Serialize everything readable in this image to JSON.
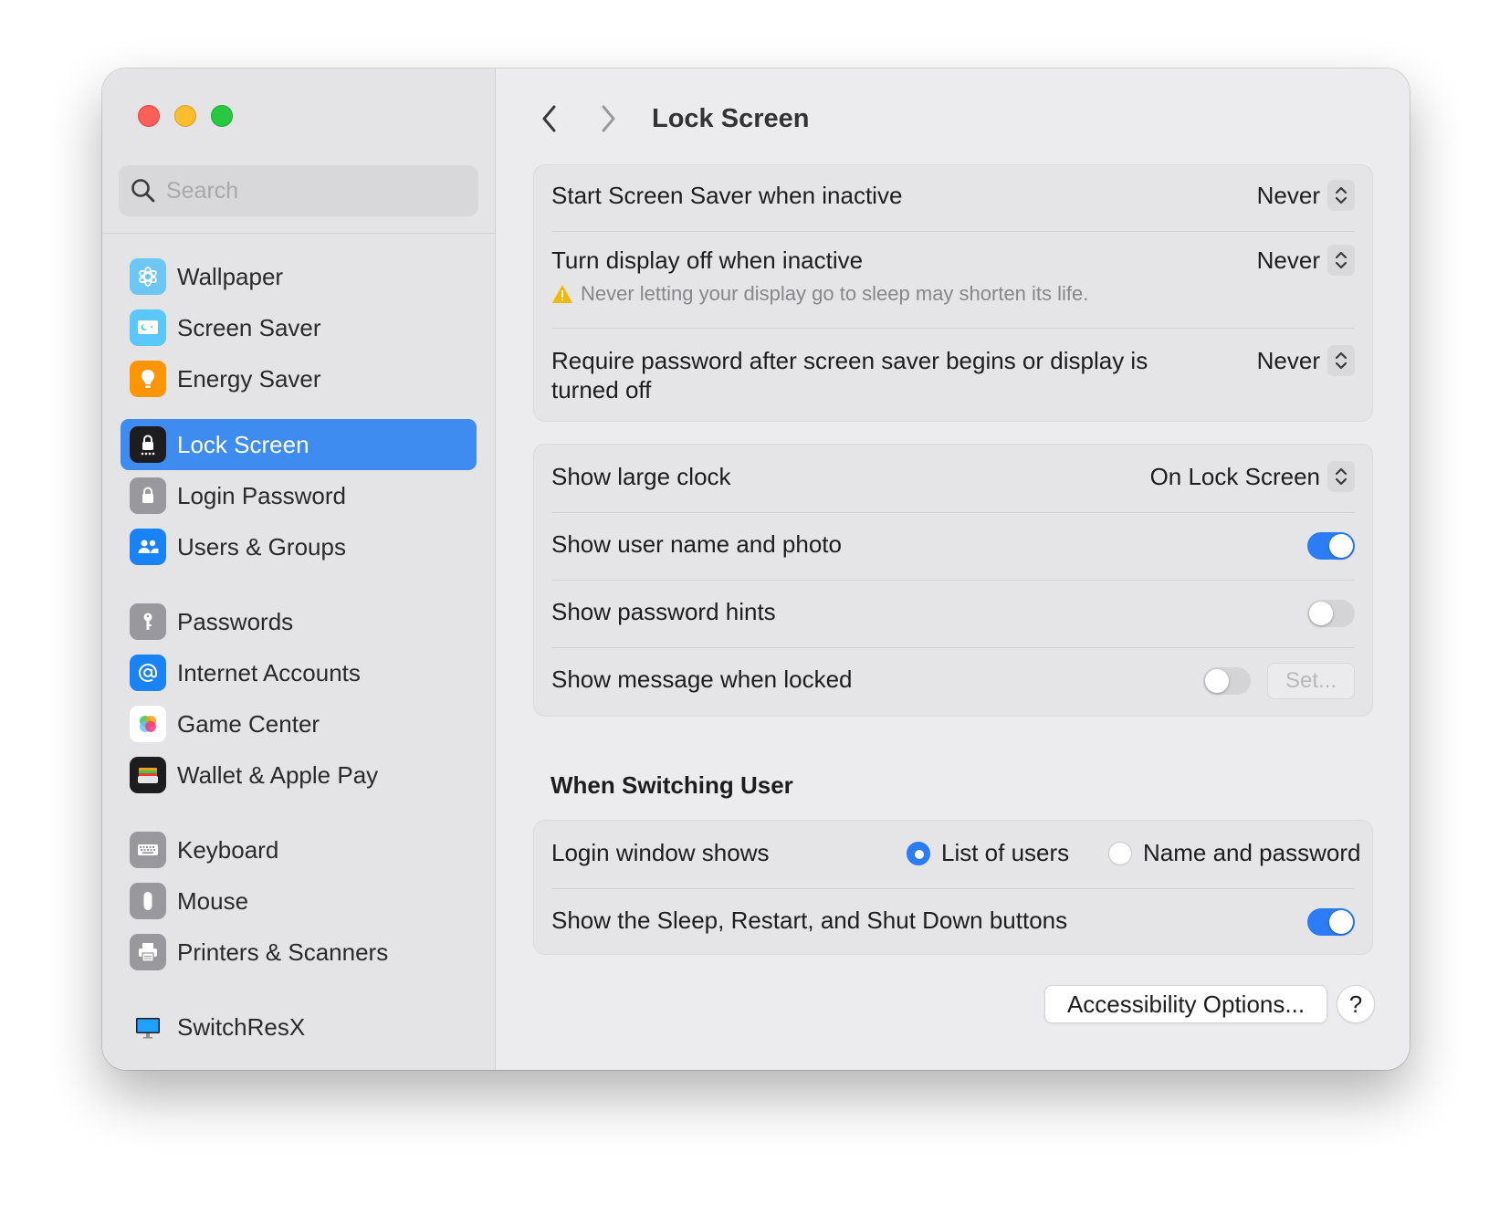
{
  "sidebar": {
    "search_placeholder": "Search",
    "items": [
      {
        "label": "Wallpaper",
        "icon": "wallpaper-icon",
        "color": "#5ac8fa"
      },
      {
        "label": "Screen Saver",
        "icon": "screen-saver-icon",
        "color": "#5ac8fa"
      },
      {
        "label": "Energy Saver",
        "icon": "energy-saver-icon",
        "color": "#ff9500"
      },
      {
        "label": "Lock Screen",
        "icon": "lock-screen-icon",
        "color": "#1d1d1f",
        "selected": true
      },
      {
        "label": "Login Password",
        "icon": "login-password-icon",
        "color": "#8e8e93"
      },
      {
        "label": "Users & Groups",
        "icon": "users-groups-icon",
        "color": "#007aff"
      },
      {
        "label": "Passwords",
        "icon": "passwords-icon",
        "color": "#8e8e93"
      },
      {
        "label": "Internet Accounts",
        "icon": "internet-accounts-icon",
        "color": "#007aff"
      },
      {
        "label": "Game Center",
        "icon": "game-center-icon",
        "color": "#ffffff"
      },
      {
        "label": "Wallet & Apple Pay",
        "icon": "wallet-icon",
        "color": "#1d1d1f"
      },
      {
        "label": "Keyboard",
        "icon": "keyboard-icon",
        "color": "#8e8e93"
      },
      {
        "label": "Mouse",
        "icon": "mouse-icon",
        "color": "#8e8e93"
      },
      {
        "label": "Printers & Scanners",
        "icon": "printer-icon",
        "color": "#8e8e93"
      },
      {
        "label": "SwitchResX",
        "icon": "switchresx-icon",
        "color": "#1e90ff"
      }
    ]
  },
  "header": {
    "title": "Lock Screen"
  },
  "group1": {
    "screen_saver": {
      "label": "Start Screen Saver when inactive",
      "value": "Never"
    },
    "display_off": {
      "label": "Turn display off when inactive",
      "value": "Never",
      "warning": "Never letting your display go to sleep may shorten its life."
    },
    "require_password": {
      "label": "Require password after screen saver begins or display is turned off",
      "value": "Never"
    }
  },
  "group2": {
    "large_clock": {
      "label": "Show large clock",
      "value": "On Lock Screen"
    },
    "user_name_photo": {
      "label": "Show user name and photo",
      "on": true
    },
    "password_hints": {
      "label": "Show password hints",
      "on": false
    },
    "message_locked": {
      "label": "Show message when locked",
      "on": false,
      "button": "Set..."
    }
  },
  "switching": {
    "title": "When Switching User",
    "login_window": {
      "label": "Login window shows",
      "options": [
        "List of users",
        "Name and password"
      ],
      "selected": "List of users"
    },
    "sleep_buttons": {
      "label": "Show the Sleep, Restart, and Shut Down buttons",
      "on": true
    }
  },
  "footer": {
    "accessibility_button": "Accessibility Options...",
    "help_button": "?"
  },
  "colors": {
    "accent": "#2c7df5",
    "selection": "#3e8cf0",
    "warning": "#f5b700"
  }
}
